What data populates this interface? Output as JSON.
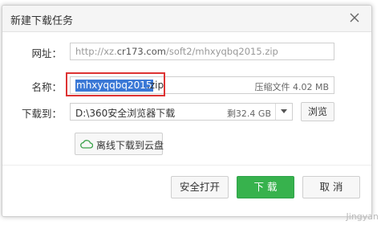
{
  "dialog": {
    "title": "新建下载任务"
  },
  "form": {
    "url_label": "网址：",
    "url_prefix": "http://xz.",
    "url_domain": "cr173.com",
    "url_suffix": "/soft2/mhxyqbq2015.zip",
    "name_label": "名称：",
    "name_selected": "mhxyqqbq2015",
    "name_ext": ".zip",
    "file_type": "压缩文件",
    "file_size": "4.02 MB",
    "dir_label": "下载到：",
    "dir_path": "D:\\360安全浏览器下载",
    "free_space": "剩32.4 GB",
    "browse_label": "浏览",
    "cloud_label": "离线下载到云盘"
  },
  "buttons": {
    "open_label": "安全打开",
    "download_label": "下 载",
    "cancel_label": "取 消"
  },
  "watermark": "Jingyan"
}
